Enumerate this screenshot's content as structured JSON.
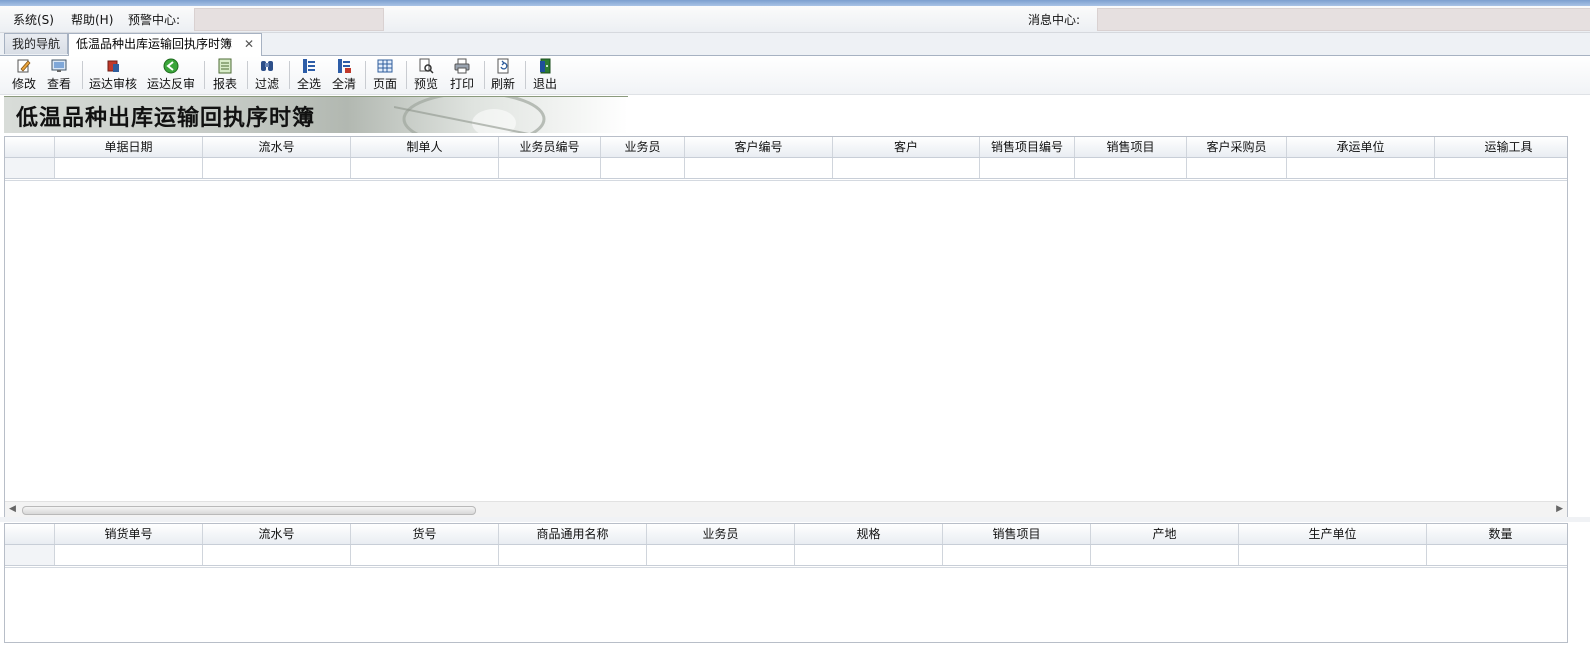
{
  "menu": {
    "system": "系统(S)",
    "help": "帮助(H)",
    "warning_center": "预警中心:",
    "message_center": "消息中心:"
  },
  "tabs": [
    {
      "label": "我的导航",
      "active": false
    },
    {
      "label": "低温品种出库运输回执序时簿",
      "active": true
    }
  ],
  "toolbar": {
    "edit": "修改",
    "view": "查看",
    "approve": "运达审核",
    "unapprove": "运达反审",
    "report": "报表",
    "filter": "过滤",
    "select_all": "全选",
    "clear_all": "全清",
    "page": "页面",
    "preview": "预览",
    "print": "打印",
    "refresh": "刷新",
    "exit": "退出"
  },
  "banner_title": "低温品种出库运输回执序时簿",
  "main_grid": {
    "columns": [
      "单据日期",
      "流水号",
      "制单人",
      "业务员编号",
      "业务员",
      "客户编号",
      "客户",
      "销售项目编号",
      "销售项目",
      "客户采购员",
      "承运单位",
      "运输工具"
    ]
  },
  "detail_grid": {
    "columns": [
      "销货单号",
      "流水号",
      "货号",
      "商品通用名称",
      "业务员",
      "规格",
      "销售项目",
      "产地",
      "生产单位",
      "数量"
    ]
  },
  "colors": {
    "title_bar": "#7c9fcf",
    "grid_border": "#b8bec8",
    "message_box": "#e6e0e0"
  }
}
